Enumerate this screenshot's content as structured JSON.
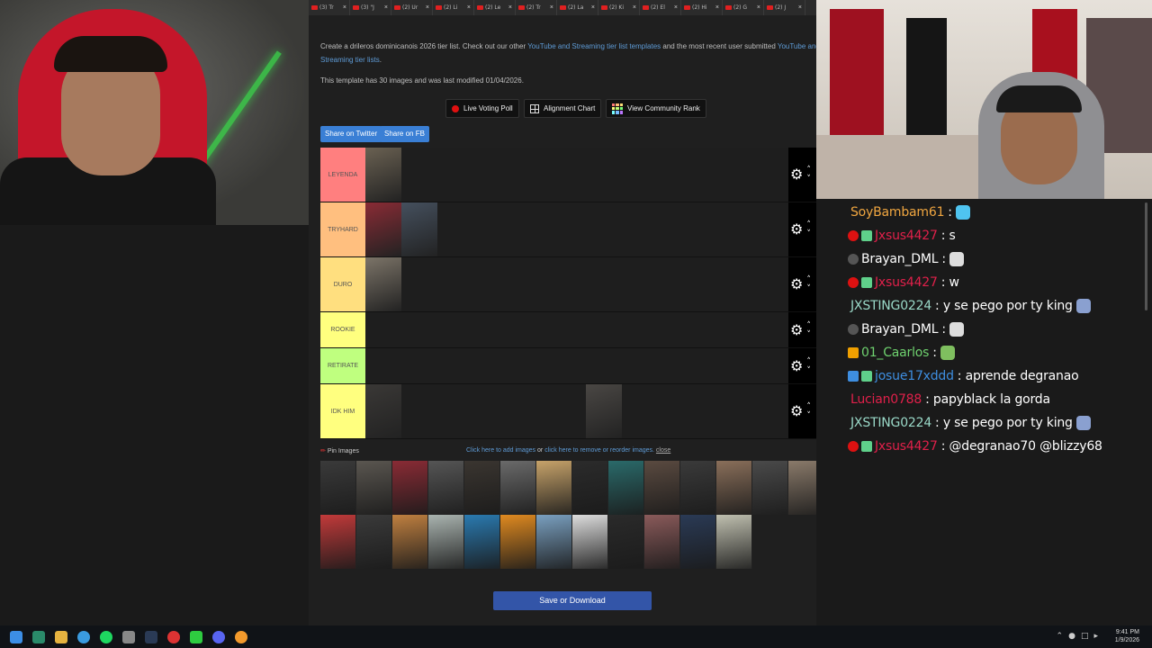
{
  "browser": {
    "tabs": [
      {
        "label": "(3) Tr"
      },
      {
        "label": "(3) \"J"
      },
      {
        "label": "(2) Ur"
      },
      {
        "label": "(2) Li"
      },
      {
        "label": "(2) Le"
      },
      {
        "label": "(2) Tr"
      },
      {
        "label": "(2) La"
      },
      {
        "label": "(2) Ki"
      },
      {
        "label": "(2) El"
      },
      {
        "label": "(2) Hi"
      },
      {
        "label": "(2) G"
      },
      {
        "label": "(2) J"
      }
    ]
  },
  "page": {
    "intro_pre": "Create a drileros dominicanois 2026 tier list. Check out our other ",
    "intro_link1": "YouTube and Streaming tier list templates",
    "intro_mid": " and the most recent user submitted ",
    "intro_link2": "YouTube and Streaming tier lists",
    "intro_end": ".",
    "modified": "This template has 30 images and was last modified 01/04/2026.",
    "buttons": {
      "live_poll": "Live Voting Poll",
      "alignment": "Alignment Chart",
      "community": "View Community Rank"
    },
    "share": {
      "twitter": "Share on Twitter",
      "fb": "Share on FB"
    },
    "tiers": [
      {
        "label": "LEYENDA",
        "color": "#ff7f7f",
        "count": 1
      },
      {
        "label": "TRYHARD",
        "color": "#ffbf7f",
        "count": 2
      },
      {
        "label": "DURO",
        "color": "#ffdf7f",
        "count": 1
      },
      {
        "label": "ROOKIE",
        "color": "#ffff7f",
        "count": 0
      },
      {
        "label": "RETIRATE",
        "color": "#bfff7f",
        "count": 0
      },
      {
        "label": "IDK HIM",
        "color": "#ffff7f",
        "count": 2
      }
    ],
    "pin_images": "Pin Images",
    "add_images": "Click here to add images",
    "or": "or",
    "remove_images": "click here to remove or reorder images.",
    "close": "close",
    "save": "Save or Download"
  },
  "chat": {
    "messages": [
      {
        "user": "SoyBambam61",
        "color": "#f0a640",
        "text": ":",
        "emote": "#4fc4f0",
        "badge": ""
      },
      {
        "user": "Jxsus4427",
        "color": "#e0204a",
        "text": ": s",
        "badge": "red"
      },
      {
        "user": "Brayan_DML",
        "color": "#ffffff",
        "text": ":",
        "emote": "#dddddd",
        "badge": "gray"
      },
      {
        "user": "Jxsus4427",
        "color": "#e0204a",
        "text": ": w",
        "badge": "red"
      },
      {
        "user": "JXSTING0224",
        "color": "#9ad9c8",
        "text": ": y se pego por ty king",
        "emote": "#8aa0d0",
        "badge": ""
      },
      {
        "user": "Brayan_DML",
        "color": "#ffffff",
        "text": ":",
        "emote": "#dddddd",
        "badge": "gray"
      },
      {
        "user": "01_Caarlos",
        "color": "#6fd26f",
        "text": ":",
        "emote": "#7fbf5f",
        "badge": "crown"
      },
      {
        "user": "josue17xddd",
        "color": "#3e8ee0",
        "text": ": aprende degranao",
        "badge": "blue"
      },
      {
        "user": "Lucian0788",
        "color": "#e0204a",
        "text": ": papyblack la gorda",
        "badge": ""
      },
      {
        "user": "JXSTING0224",
        "color": "#9ad9c8",
        "text": ": y se pego por ty king",
        "emote": "#8aa0d0",
        "badge": ""
      },
      {
        "user": "Jxsus4427",
        "color": "#e0204a",
        "text": ": @degranao70 @blizzy68",
        "badge": "red"
      }
    ]
  },
  "taskbar": {
    "time": "9:41 PM",
    "date": "1/9/2026"
  }
}
